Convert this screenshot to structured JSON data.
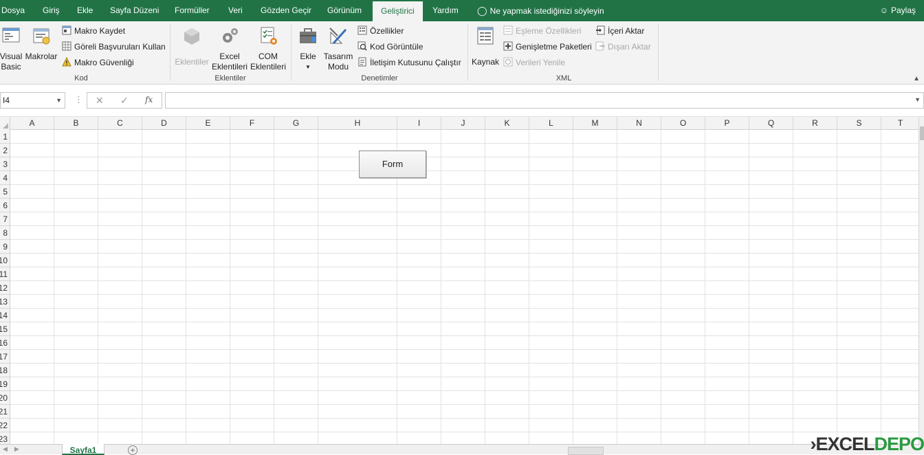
{
  "tabs": [
    {
      "label": "Dosya",
      "active": false
    },
    {
      "label": "Giriş",
      "active": false
    },
    {
      "label": "Ekle",
      "active": false
    },
    {
      "label": "Sayfa Düzeni",
      "active": false
    },
    {
      "label": "Formüller",
      "active": false
    },
    {
      "label": "Veri",
      "active": false
    },
    {
      "label": "Gözden Geçir",
      "active": false
    },
    {
      "label": "Görünüm",
      "active": false
    },
    {
      "label": "Geliştirici",
      "active": true
    },
    {
      "label": "Yardım",
      "active": false
    }
  ],
  "tellme": "Ne yapmak istediğinizi söyleyin",
  "share": "Paylaş",
  "ribbon": {
    "kod": {
      "label": "Kod",
      "visual_basic_1": "Visual",
      "visual_basic_2": "Basic",
      "makrolar": "Makrolar",
      "makro_kaydet": "Makro Kaydet",
      "goreli": "Göreli Başvuruları Kullan",
      "makro_guvenligi": "Makro Güvenliği"
    },
    "eklentiler": {
      "label": "Eklentiler",
      "eklentiler_btn": "Eklentiler",
      "excel_1": "Excel",
      "excel_2": "Eklentileri",
      "com_1": "COM",
      "com_2": "Eklentileri"
    },
    "denetimler": {
      "label": "Denetimler",
      "ekle": "Ekle",
      "tasarim_1": "Tasarım",
      "tasarim_2": "Modu",
      "ozellikler": "Özellikler",
      "kod_goruntule": "Kod Görüntüle",
      "iletisim": "İletişim Kutusunu Çalıştır"
    },
    "xml": {
      "label": "XML",
      "kaynak": "Kaynak",
      "esleme": "Eşleme Özellikleri",
      "genisletme": "Genişletme Paketleri",
      "verileri_yenile": "Verileri Yenile",
      "iceri_aktar": "İçeri Aktar",
      "disari_aktar": "Dışarı Aktar"
    }
  },
  "namebox": "I4",
  "fx": "fx",
  "columns": [
    "A",
    "B",
    "C",
    "D",
    "E",
    "F",
    "G",
    "H",
    "I",
    "J",
    "K",
    "L",
    "M",
    "N",
    "O",
    "P",
    "Q",
    "R",
    "S",
    "T"
  ],
  "rows": [
    "1",
    "2",
    "3",
    "4",
    "5",
    "6",
    "7",
    "8",
    "9",
    "10",
    "11",
    "12",
    "13",
    "14",
    "15",
    "16",
    "17",
    "18",
    "19",
    "20",
    "21",
    "22",
    "23"
  ],
  "form_button": "Form",
  "sheet_tab": "Sayfa1",
  "logo_a": "EXCEL",
  "logo_b": "DEPO",
  "colors": {
    "accent": "#217346",
    "logo_green": "#2a9a40"
  }
}
